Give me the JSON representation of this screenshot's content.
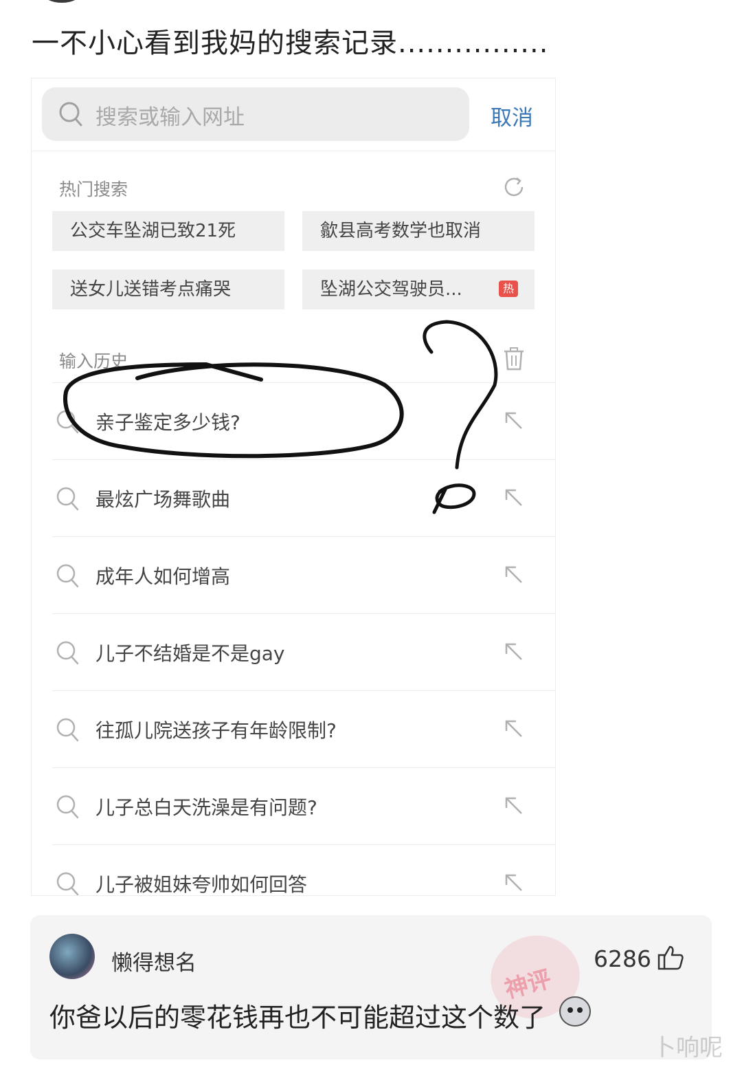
{
  "post": {
    "title": "一不小心看到我妈的搜索记录................"
  },
  "browser": {
    "search_placeholder": "搜索或输入网址",
    "cancel_label": "取消",
    "hot_search_label": "热门搜索",
    "hot_items": [
      {
        "label": "公交车坠湖已致21死"
      },
      {
        "label": "歙县高考数学也取消"
      },
      {
        "label": "送女儿送错考点痛哭"
      },
      {
        "label": "坠湖公交驾驶员...",
        "badge": "热"
      }
    ],
    "history_label": "输入历史",
    "history_items": [
      "亲子鉴定多少钱?",
      "最炫广场舞歌曲",
      "成年人如何增高",
      "儿子不结婚是不是gay",
      "往孤儿院送孩子有年龄限制?",
      "儿子总白天洗澡是有问题?",
      "儿子被姐妹夸帅如何回答"
    ]
  },
  "comment": {
    "username": "懒得想名",
    "like_count": "6286",
    "text": "你爸以后的零花钱再也不可能超过这个数了",
    "stamp_text": "神评"
  },
  "watermark": "卜响呢",
  "icons": [
    "search-icon",
    "refresh-icon",
    "trash-icon",
    "arrow-up-left-icon",
    "thumbs-up-icon"
  ],
  "colors": {
    "accent": "#3b78b8",
    "hot_badge": "#e8524a",
    "card_bg": "#f4f4f4"
  }
}
